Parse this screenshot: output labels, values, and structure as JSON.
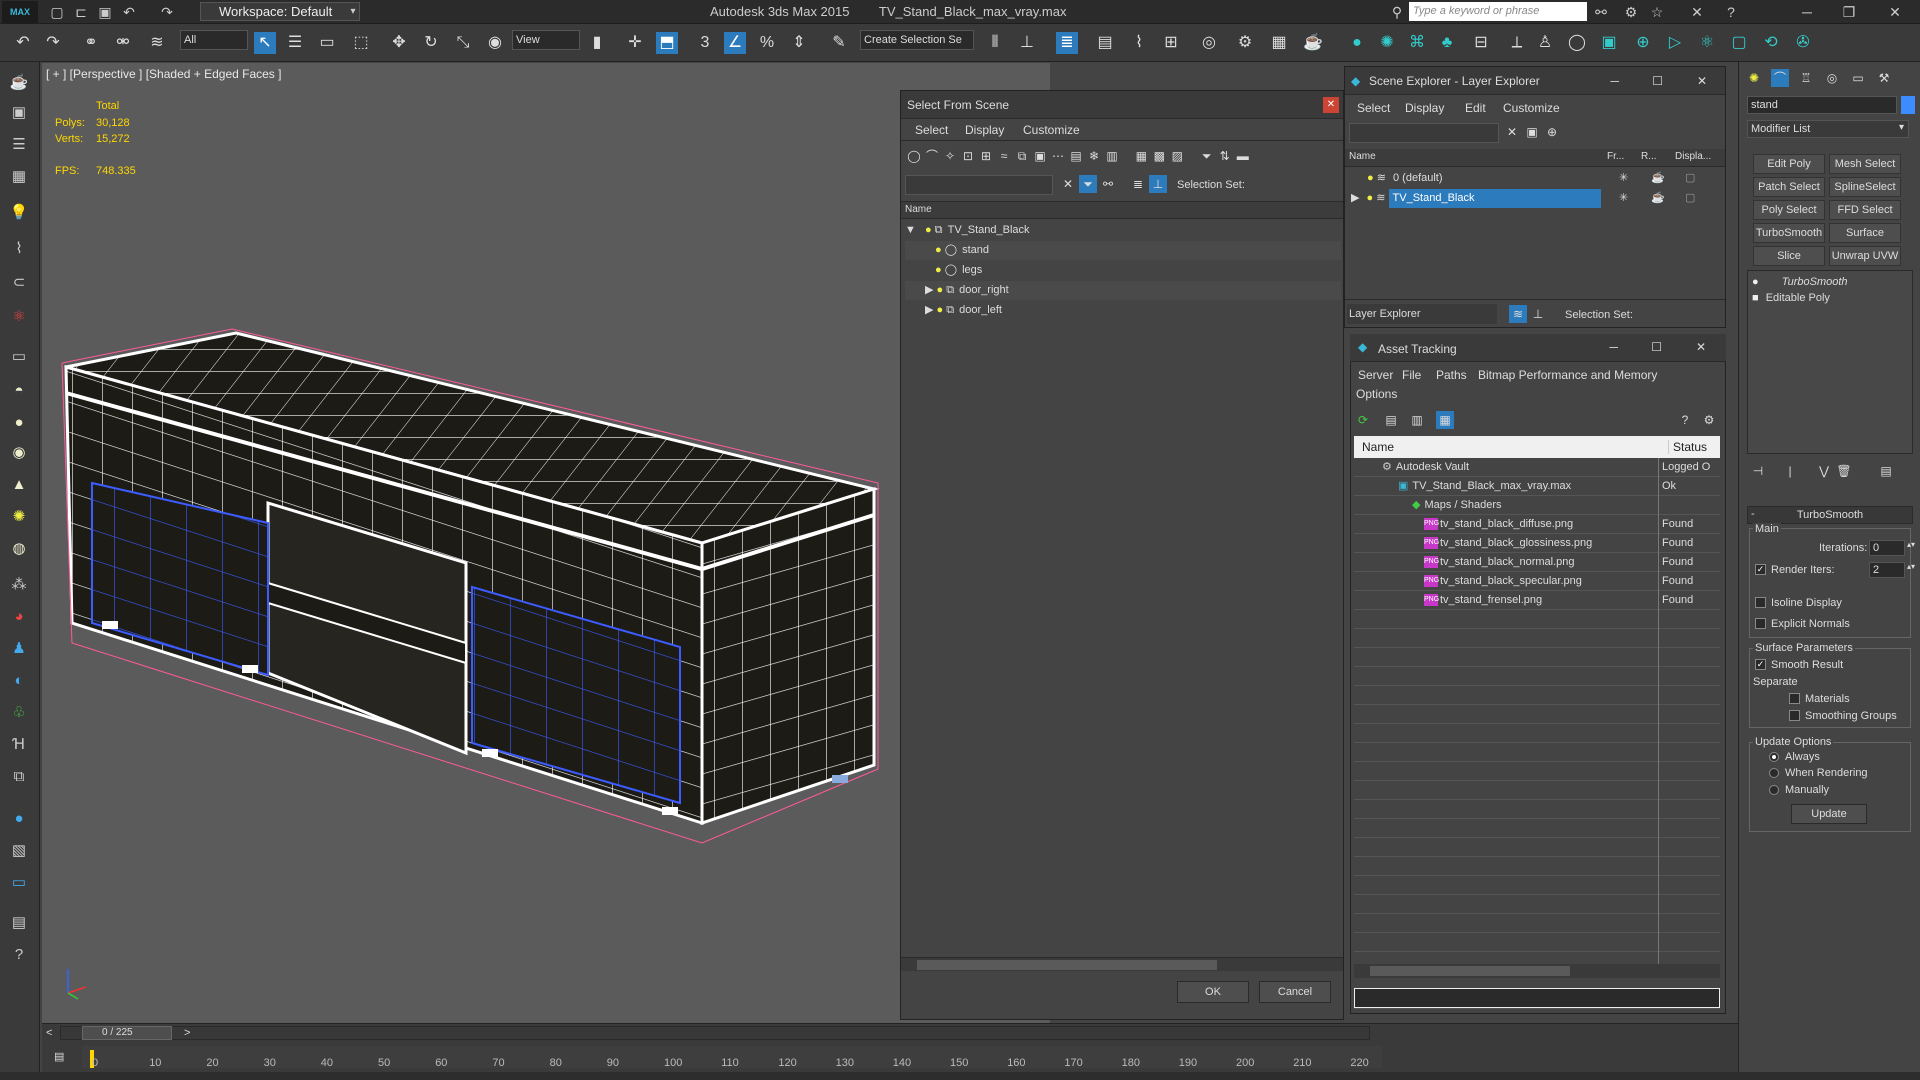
{
  "app": {
    "title": "Autodesk 3ds Max  2015",
    "filename": "TV_Stand_Black_max_vray.max",
    "workspace": "Workspace: Default",
    "search_placeholder": "Type a keyword or phrase",
    "logo": "MAX"
  },
  "toolbar": {
    "selection_filter": "All",
    "ref_coord": "View",
    "named_selection": "Create Selection Se",
    "snap_value": "3",
    "angle_snap_label": "%"
  },
  "viewport": {
    "label": "[ + ] [Perspective ] [Shaded + Edged Faces ]",
    "stats": {
      "total_label": "Total",
      "polys_label": "Polys:",
      "polys_value": "30,128",
      "verts_label": "Verts:",
      "verts_value": "15,272",
      "fps_label": "FPS:",
      "fps_value": "748.335"
    },
    "model_color": "#1c1b16",
    "wire_color": "#ffffff",
    "selection_color": "#3c5cff"
  },
  "select_from_scene": {
    "title": "Select From Scene",
    "menus": [
      "Select",
      "Display",
      "Customize"
    ],
    "selection_set_label": "Selection Set:",
    "column_name": "Name",
    "tree": [
      {
        "label": "TV_Stand_Black",
        "expanded": true
      },
      {
        "label": "stand"
      },
      {
        "label": "legs"
      },
      {
        "label": "door_right",
        "expandable": true
      },
      {
        "label": "door_left",
        "expandable": true
      }
    ],
    "ok_label": "OK",
    "cancel_label": "Cancel"
  },
  "scene_explorer": {
    "title": "Scene Explorer - Layer Explorer",
    "menus": [
      "Select",
      "Display",
      "Edit",
      "Customize"
    ],
    "columns": [
      "Name",
      "Fr...",
      "R...",
      "Displa..."
    ],
    "layers": [
      {
        "label": "0 (default)",
        "selected": false
      },
      {
        "label": "TV_Stand_Black",
        "selected": true
      }
    ],
    "footer_combo": "Layer Explorer",
    "selection_set_label": "Selection Set:"
  },
  "asset_tracking": {
    "title": "Asset Tracking",
    "menus": [
      "Server",
      "File",
      "Paths",
      "Bitmap Performance and Memory"
    ],
    "menus2": [
      "Options"
    ],
    "columns": [
      "Name",
      "Status"
    ],
    "rows": [
      {
        "name": "Autodesk Vault",
        "status": "Logged O",
        "level": 0,
        "type": "vault"
      },
      {
        "name": "TV_Stand_Black_max_vray.max",
        "status": "Ok",
        "level": 1,
        "type": "max"
      },
      {
        "name": "Maps / Shaders",
        "status": "",
        "level": 2,
        "type": "folder"
      },
      {
        "name": "tv_stand_black_diffuse.png",
        "status": "Found",
        "level": 3,
        "type": "png"
      },
      {
        "name": "tv_stand_black_glossiness.png",
        "status": "Found",
        "level": 3,
        "type": "png"
      },
      {
        "name": "tv_stand_black_normal.png",
        "status": "Found",
        "level": 3,
        "type": "png"
      },
      {
        "name": "tv_stand_black_specular.png",
        "status": "Found",
        "level": 3,
        "type": "png"
      },
      {
        "name": "tv_stand_frensel.png",
        "status": "Found",
        "level": 3,
        "type": "png"
      }
    ],
    "png_badge": "PNG"
  },
  "command_panel": {
    "object_name": "stand",
    "modifier_list": "Modifier List",
    "modifier_buttons": [
      "Edit Poly",
      "Mesh Select",
      "Patch Select",
      "SplineSelect",
      "Poly Select",
      "FFD Select",
      "TurboSmooth",
      "Surface Select",
      "Slice",
      "Unwrap UVW"
    ],
    "stack": [
      "TurboSmooth",
      "Editable Poly"
    ],
    "turbosmooth": {
      "rollout": "TurboSmooth",
      "main_label": "Main",
      "iterations_label": "Iterations:",
      "iterations_value": "0",
      "render_iters_label": "Render Iters:",
      "render_iters_value": "2",
      "render_iters_checked": true,
      "isoline_label": "Isoline Display",
      "explicit_label": "Explicit Normals",
      "surface_params_label": "Surface Parameters",
      "smooth_result_label": "Smooth Result",
      "separate_label": "Separate",
      "materials_label": "Materials",
      "smoothing_groups_label": "Smoothing Groups",
      "update_options_label": "Update Options",
      "always_label": "Always",
      "when_rendering_label": "When Rendering",
      "manually_label": "Manually",
      "update_button": "Update"
    }
  },
  "timeline": {
    "frame_display": "0 / 225",
    "ticks": [
      "0",
      "10",
      "20",
      "30",
      "40",
      "50",
      "60",
      "70",
      "80",
      "90",
      "100",
      "110",
      "120",
      "130",
      "140",
      "150",
      "160",
      "170",
      "180",
      "190",
      "200",
      "210",
      "220"
    ]
  }
}
